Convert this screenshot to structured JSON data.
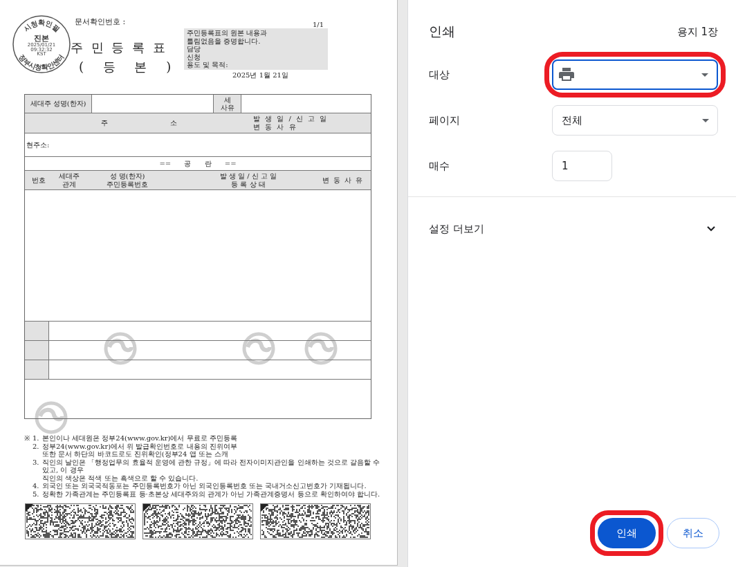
{
  "preview": {
    "document": {
      "confirmation_label": "문서확인번호 :",
      "page_number": "1/1",
      "stamp": {
        "top": "시청확인필",
        "main": "진본",
        "date": "2025/01/21",
        "time": "09:32:32",
        "zone": "KST",
        "bottom": "정부시청확인센터"
      },
      "title": [
        "주 민 등 록 표",
        "( 등 본 )"
      ],
      "certification": {
        "lines": [
          "주민등록표의 원본 내용과",
          "틀림없음을 증명합니다.",
          "담당",
          "신청",
          "용도 및 목적:"
        ],
        "date": "2025년 1월 21일"
      },
      "household": {
        "head_label": "세대주 성명(한자)",
        "reason_label": [
          "세",
          "사유"
        ]
      },
      "address_header": {
        "address": [
          "주",
          "소"
        ],
        "date": "발 생 일 / 신 고 일",
        "reason": "변 동 사 유"
      },
      "current_address_label": "현주소:",
      "blank_marker": "== 공 란 ==",
      "member_columns": [
        {
          "lines": [
            "번호"
          ]
        },
        {
          "lines": [
            "세대주",
            "관계"
          ]
        },
        {
          "lines": [
            "성 명(한자)",
            "주민등록번호"
          ]
        },
        {
          "lines": [
            "발 생 일 / 신 고 일",
            "등 록 상 태"
          ]
        },
        {
          "lines": [
            "변 동 사 유"
          ]
        }
      ],
      "notes": {
        "mark": "※",
        "items": [
          {
            "number": "1.",
            "lines": [
              "본인이나 세대원은 정부24(www.gov.kr)에서 무료로 주민등록"
            ]
          },
          {
            "number": "2.",
            "lines": [
              "정부24(www.gov.kr)에서 위 발급확인번호로 내용의 진위여부",
              "또한 문서 하단의 바코드로도 진위확인(정부24 앱 또는 스캐"
            ]
          },
          {
            "number": "3.",
            "lines": [
              "직인의 날인은 「행정업무의 효율적 운영에 관한 규정」에 따라 전자이미지관인을 인쇄하는 것으로 갈음할 수 있고, 이 경우",
              "직인의 색상은 적색 또는 흑색으로 할 수 있습니다."
            ]
          },
          {
            "number": "4.",
            "lines": [
              "외국인 또는 외국국적동포는 주민등록번호가 아닌 외국인등록번호 또는 국내거소신고번호가 기재됩니다."
            ]
          },
          {
            "number": "5.",
            "lines": [
              "정확한 가족관계는 주민등록표 등·초본상 세대주와의 관계가 아닌 가족관계증명서 등으로 확인하여야 합니다."
            ]
          }
        ]
      },
      "barcodes": [
        {
          "kind": "barcode"
        },
        {
          "kind": "barcode"
        },
        {
          "kind": "barcode"
        }
      ]
    }
  },
  "panel": {
    "title": "인쇄",
    "sheet_count": "용지 1장",
    "settings": [
      {
        "kind": "printer-select",
        "label": "대상",
        "annotated": true
      },
      {
        "kind": "select",
        "label": "페이지",
        "value": "전체"
      },
      {
        "kind": "number",
        "label": "매수",
        "value": "1"
      }
    ],
    "more_settings": {
      "label": "설정 더보기",
      "expanded": false
    },
    "buttons": [
      {
        "label": "인쇄",
        "kind": "primary",
        "annotated": true
      },
      {
        "label": "취소",
        "kind": "secondary"
      }
    ]
  }
}
